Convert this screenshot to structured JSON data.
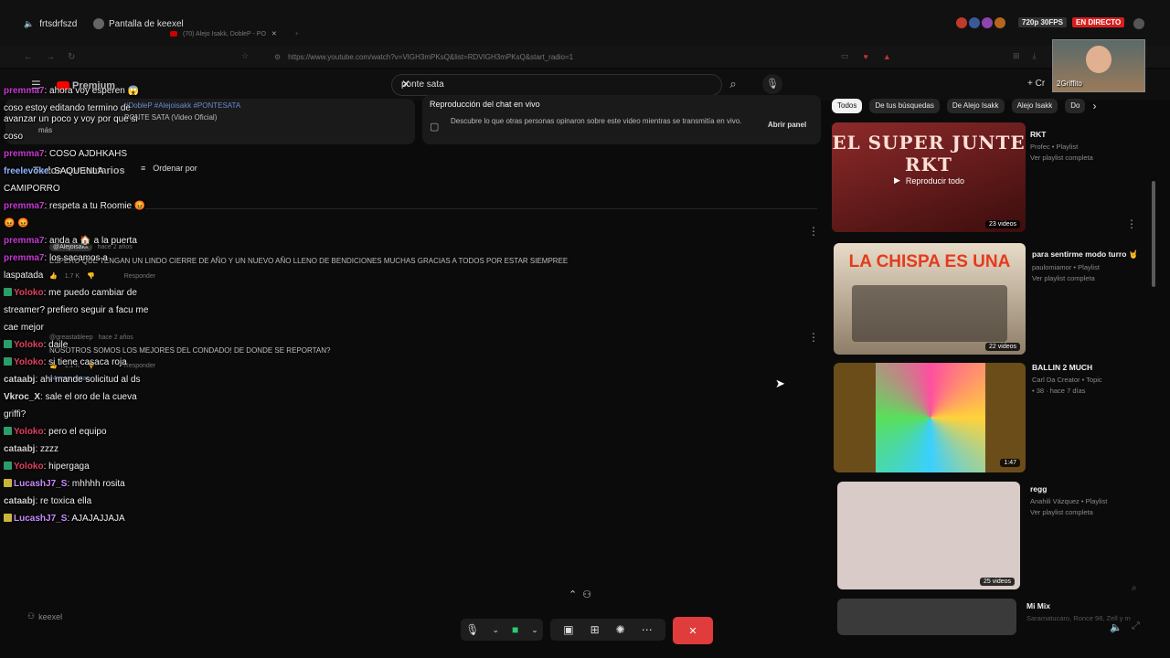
{
  "stream_bar": {
    "channel_left": "frtsdrfszd",
    "screen_label": "Pantalla de keexel",
    "quality": "720p 30FPS",
    "live": "EN DIRECTO",
    "tab_title": "(70) Alejo Isakk, DobleP - PO",
    "url": "https://www.youtube.com/watch?v=VIGH3mPKsQ&list=RDVIGH3mPKsQ&start_radio=1"
  },
  "youtube": {
    "logo": "Premium",
    "search_value": "ponte sata",
    "create_label": "+ Cr"
  },
  "video_info": {
    "hashtags": "#DobleP #Alejoisakk #PONTESATA",
    "title_line": "PONTE SATA (Video Oficial)",
    "more": "más"
  },
  "live_chat_panel": {
    "title": "Reproducción del chat en vivo",
    "description": "Descubre lo que otras personas opinaron sobre este video mientras se transmitía en vivo.",
    "button": "Abrir panel"
  },
  "comments": {
    "header": "Todos comentarios",
    "sort": "Ordenar por",
    "items": [
      {
        "author": "@Alejoisakk",
        "time": "hace 2 años",
        "text": "ESPERO QUE TENGAN UN LINDO CIERRE DE AÑO Y UN NUEVO AÑO LLENO DE BENDICIONES MUCHAS GRACIAS A TODOS POR ESTAR SIEMPREE",
        "likes": "1.7 K",
        "reply": "Responder"
      },
      {
        "author": "@greastableep",
        "time": "hace 2 años",
        "text": "NOSOTROS SOMOS LOS MEJORES DEL CONDADO! DE DONDE SE REPORTAN?",
        "likes": "1.1 K",
        "reply": "Responder",
        "replies": "34 respuestas"
      }
    ]
  },
  "chat": [
    {
      "user": "premma7",
      "cls": "u-premma",
      "text": ": ahora voy esperen 😱",
      "badge": ""
    },
    {
      "user": "",
      "cls": "",
      "text": "coso estoy editando termino de avanzar un poco y voy por que si",
      "badge": ""
    },
    {
      "user": "",
      "cls": "",
      "text": "coso",
      "badge": ""
    },
    {
      "user": "premma7",
      "cls": "u-premma",
      "text": ": COSO AJDHKAHS",
      "badge": ""
    },
    {
      "user": "freelevoke",
      "cls": "u-free",
      "text": ": SAQUENLA",
      "badge": ""
    },
    {
      "user": "",
      "cls": "",
      "text": "CAMIPORRO",
      "badge": ""
    },
    {
      "user": "premma7",
      "cls": "u-premma",
      "text": ": respeta a tu Roomie 😡",
      "badge": ""
    },
    {
      "user": "",
      "cls": "",
      "text": "😡 😡",
      "badge": ""
    },
    {
      "user": "premma7",
      "cls": "u-premma",
      "text": ": anda a 🏠 a la puerta",
      "badge": ""
    },
    {
      "user": "premma7",
      "cls": "u-premma",
      "text": ": los sacamos a",
      "badge": ""
    },
    {
      "user": "",
      "cls": "",
      "text": "laspatada",
      "badge": ""
    },
    {
      "user": "Yoloko",
      "cls": "u-yoloko",
      "text": ": me puedo cambiar de",
      "badge": "g"
    },
    {
      "user": "",
      "cls": "",
      "text": "streamer? prefiero seguir a facu me",
      "badge": ""
    },
    {
      "user": "",
      "cls": "",
      "text": "cae mejor",
      "badge": ""
    },
    {
      "user": "Yoloko",
      "cls": "u-yoloko",
      "text": ": daile",
      "badge": "g"
    },
    {
      "user": "Yoloko",
      "cls": "u-yoloko",
      "text": ": si tiene casaca roja",
      "badge": "g"
    },
    {
      "user": "cataabj",
      "cls": "u-cata",
      "text": ": ahi mande solicitud al ds",
      "badge": ""
    },
    {
      "user": "Vkroc_X",
      "cls": "u-vkroc",
      "text": ": sale el oro de la cueva",
      "badge": ""
    },
    {
      "user": "",
      "cls": "",
      "text": "griffi?",
      "badge": ""
    },
    {
      "user": "Yoloko",
      "cls": "u-yoloko",
      "text": ": pero el equipo",
      "badge": "g"
    },
    {
      "user": "cataabj",
      "cls": "u-cata",
      "text": ": zzzz",
      "badge": ""
    },
    {
      "user": "Yoloko",
      "cls": "u-yoloko",
      "text": ": hipergaga",
      "badge": "g"
    },
    {
      "user": "LucashJ7_S",
      "cls": "u-lucash",
      "text": ": mhhhh rosita",
      "badge": "y"
    },
    {
      "user": "cataabj",
      "cls": "u-cata",
      "text": ": re toxica ella",
      "badge": ""
    },
    {
      "user": "LucashJ7_S",
      "cls": "u-lucash",
      "text": ": AJAJAJJAJA",
      "badge": "y"
    }
  ],
  "chips": [
    "Todos",
    "De tus búsquedas",
    "De Alejo Isakk",
    "Alejo Isakk",
    "Do"
  ],
  "playlists": [
    {
      "title": "RKT",
      "meta1": "Profec • Playlist",
      "meta2": "Ver playlist completa",
      "count": "23 videos",
      "overlay": "Reproducir todo",
      "thumb_text": "EL SUPER JUNTE RKT",
      "color": "#7a2222"
    },
    {
      "title": "para sentirme modo turro 🤘",
      "meta1": "paulomiamor • Playlist",
      "meta2": "Ver playlist completa",
      "count": "22 videos",
      "thumb_text": "LA CHISPA ES UNA",
      "color": "#c9b89a"
    },
    {
      "title": "BALLIN 2 MUCH",
      "meta1": "Carl Da Creator • Topic",
      "meta2": "• 38 · hace 7 días",
      "count": "1:47",
      "color": "#6b4d1a"
    },
    {
      "title": "regg",
      "meta1": "Anahili Vázquez • Playlist",
      "meta2": "Ver playlist completa",
      "count": "25 videos",
      "color": "#d8cbc8"
    },
    {
      "title": "Mi Mix",
      "meta1": "Saramatucaro, Ronce 98, Zell y m",
      "meta2": "",
      "count": "",
      "color": "#3a3a3a"
    }
  ],
  "webcam": {
    "name": "2Griffito"
  },
  "bottom": {
    "user": "keexel"
  }
}
